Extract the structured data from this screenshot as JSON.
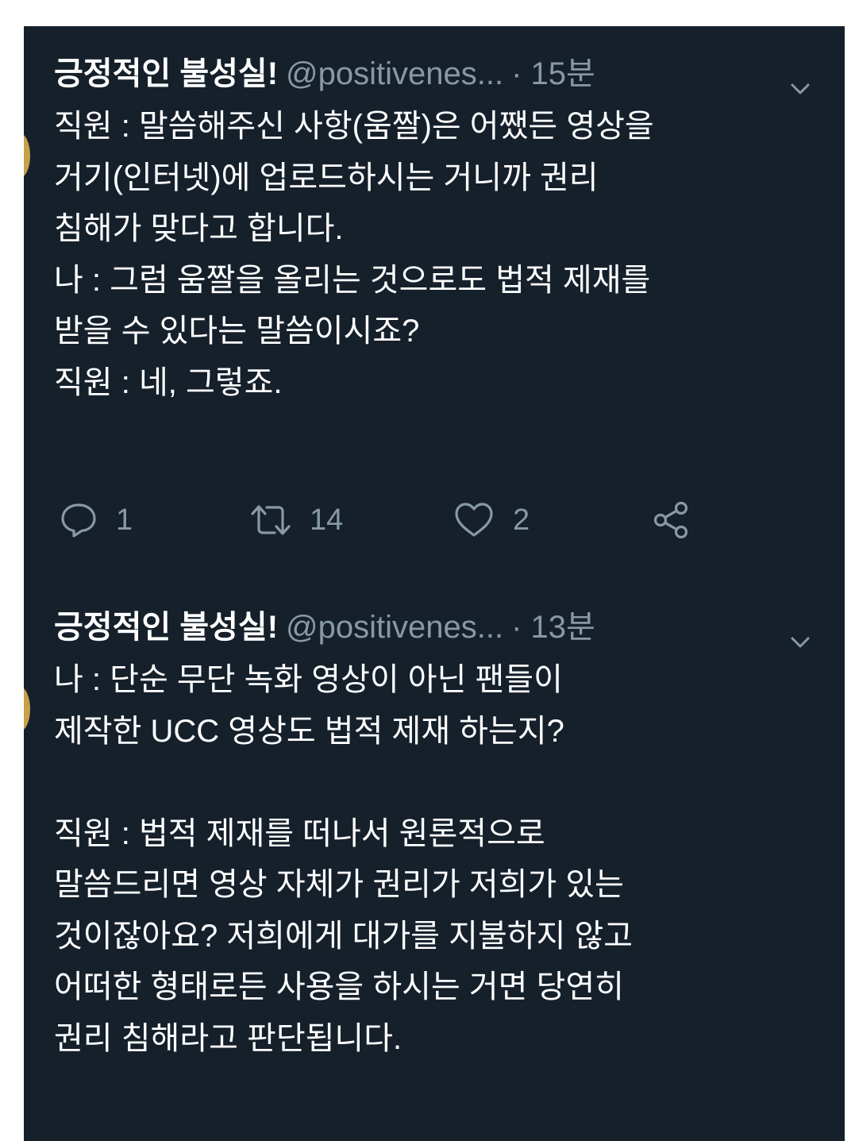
{
  "tweets": [
    {
      "name": "긍정적인 불성실!",
      "handle": "@positivenes...",
      "time": "· 15분",
      "text": "직원 : 말씀해주신 사항(움짤)은 어쨌든 영상을\n거기(인터넷)에 업로드하시는 거니까 권리\n침해가 맞다고 합니다.\n나 : 그럼 움짤을 올리는 것으로도 법적 제재를\n받을 수 있다는 말씀이시죠?\n직원 : 네, 그렇죠.",
      "actions": {
        "reply_count": "1",
        "retweet_count": "14",
        "like_count": "2"
      }
    },
    {
      "name": "긍정적인 불성실!",
      "handle": "@positivenes...",
      "time": "· 13분",
      "text": "나 : 단순 무단 녹화 영상이 아닌 팬들이\n제작한 UCC 영상도 법적 제재 하는지?\n\n직원 : 법적 제재를 떠나서 원론적으로\n말씀드리면 영상 자체가 권리가 저희가 있는\n것이잖아요? 저희에게 대가를 지불하지 않고\n어떠한 형태로든 사용을 하시는 거면 당연히\n권리 침해라고 판단됩니다."
    }
  ],
  "icons": {
    "reply": "reply-icon",
    "retweet": "retweet-icon",
    "like": "heart-icon",
    "share": "share-icon",
    "more": "chevron-down-icon"
  },
  "colors": {
    "background": "#15202b",
    "text": "#ffffff",
    "secondary": "#8899a6",
    "avatar_edge": "#c7a04a"
  }
}
